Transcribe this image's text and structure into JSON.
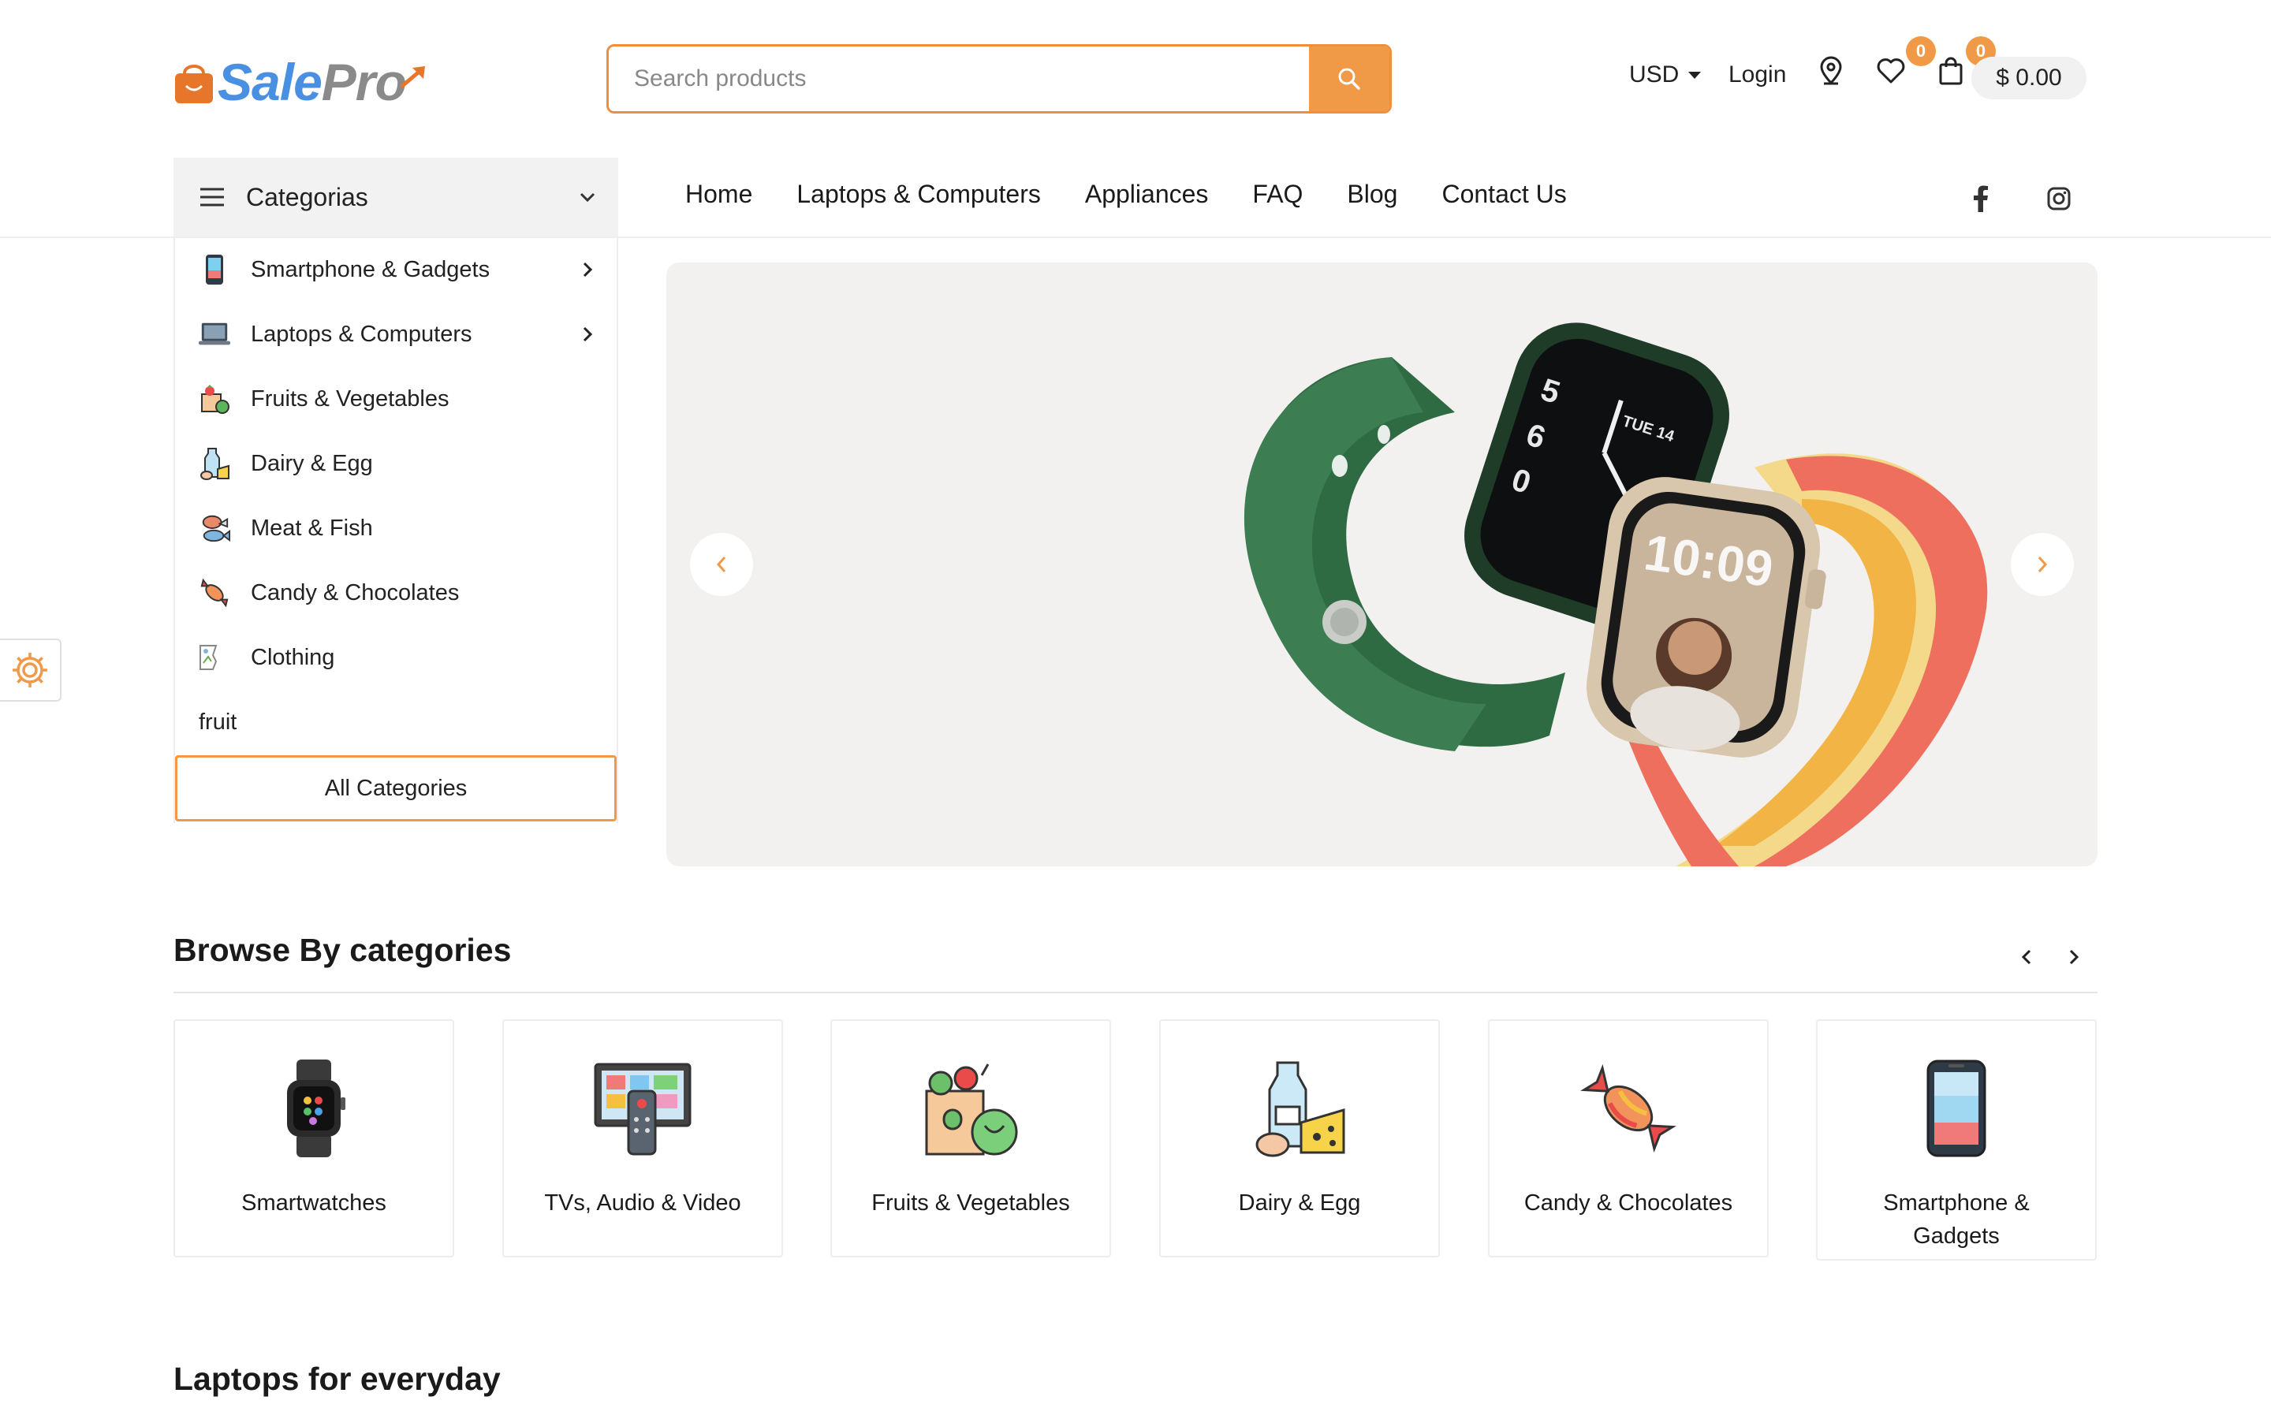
{
  "brand": {
    "name_part1": "Sale",
    "name_part2": "Pro"
  },
  "search": {
    "placeholder": "Search products"
  },
  "header": {
    "currency": "USD",
    "login": "Login",
    "wishlist_count": "0",
    "cart_count": "0",
    "cart_total": "$ 0.00"
  },
  "categories_menu": {
    "title": "Categorias",
    "items": [
      {
        "label": "Smartphone & Gadgets",
        "has_sub": true
      },
      {
        "label": "Laptops & Computers",
        "has_sub": true
      },
      {
        "label": "Fruits & Vegetables",
        "has_sub": false
      },
      {
        "label": "Dairy & Egg",
        "has_sub": false
      },
      {
        "label": "Meat & Fish",
        "has_sub": false
      },
      {
        "label": "Candy & Chocolates",
        "has_sub": false
      },
      {
        "label": "Clothing",
        "has_sub": false
      },
      {
        "label": "fruit",
        "has_sub": false
      }
    ],
    "all_label": "All Categories"
  },
  "nav": {
    "items": [
      "Home",
      "Laptops & Computers",
      "Appliances",
      "FAQ",
      "Blog",
      "Contact Us"
    ]
  },
  "hero": {
    "watch_day": "TUE 14",
    "watch_time": "10:09"
  },
  "browse": {
    "title": "Browse By categories",
    "cards": [
      {
        "label": "Smartwatches",
        "icon": "smartwatch-icon"
      },
      {
        "label": "TVs, Audio & Video",
        "icon": "tv-icon"
      },
      {
        "label": "Fruits & Vegetables",
        "icon": "grocery-bag-icon"
      },
      {
        "label": "Dairy & Egg",
        "icon": "dairy-icon"
      },
      {
        "label": "Candy & Chocolates",
        "icon": "candy-icon"
      },
      {
        "label": "Smartphone & Gadgets",
        "icon": "smartphone-icon"
      }
    ]
  },
  "laptops_section": {
    "title": "Laptops for everyday"
  },
  "colors": {
    "accent": "#f09a48",
    "brand_blue": "#4a90e2"
  }
}
